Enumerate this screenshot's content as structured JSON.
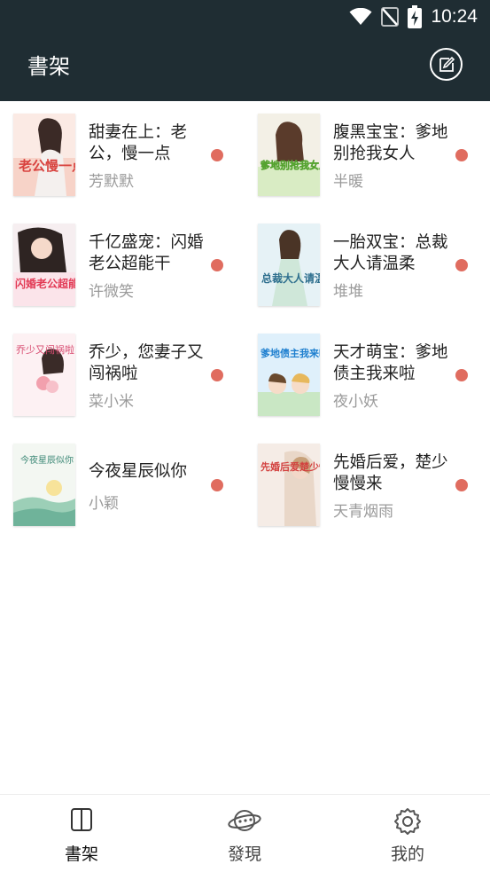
{
  "status_bar": {
    "time": "10:24",
    "icons": [
      "wifi-icon",
      "no-signal-icon",
      "battery-charging-icon"
    ]
  },
  "app_bar": {
    "title": "書架",
    "action_icon": "edit-note-icon"
  },
  "books": [
    {
      "title": "甜妻在上：老公，慢一点",
      "author": "芳默默",
      "unread": true
    },
    {
      "title": "腹黑宝宝：爹地别抢我女人",
      "author": "半暖",
      "unread": true
    },
    {
      "title": "千亿盛宠：闪婚老公超能干",
      "author": "许微笑",
      "unread": true
    },
    {
      "title": "一胎双宝：总裁大人请温柔",
      "author": "堆堆",
      "unread": true
    },
    {
      "title": "乔少，您妻子又闯祸啦",
      "author": "菜小米",
      "unread": true
    },
    {
      "title": "天才萌宝：爹地债主我来啦",
      "author": "夜小妖",
      "unread": true
    },
    {
      "title": "今夜星辰似你",
      "author": "小颖",
      "unread": true
    },
    {
      "title": "先婚后爱，楚少慢慢来",
      "author": "天青烟雨",
      "unread": true
    }
  ],
  "cover_texts": [
    "老公慢一点",
    "爹地别抢我女人",
    "闪婚老公超能干",
    "总裁大人请温柔",
    "乔少又闯祸啦",
    "爹地债主我来啦",
    "今夜星辰似你",
    "先婚后爱楚少慢慢来"
  ],
  "bottom_nav": [
    {
      "label": "書架",
      "icon": "book-icon",
      "active": true
    },
    {
      "label": "發現",
      "icon": "planet-icon",
      "active": false
    },
    {
      "label": "我的",
      "icon": "gear-icon",
      "active": false
    }
  ],
  "colors": {
    "bar_bg": "#1f2d33",
    "unread_dot": "#e06c5f",
    "author_text": "#9a9a9a"
  }
}
